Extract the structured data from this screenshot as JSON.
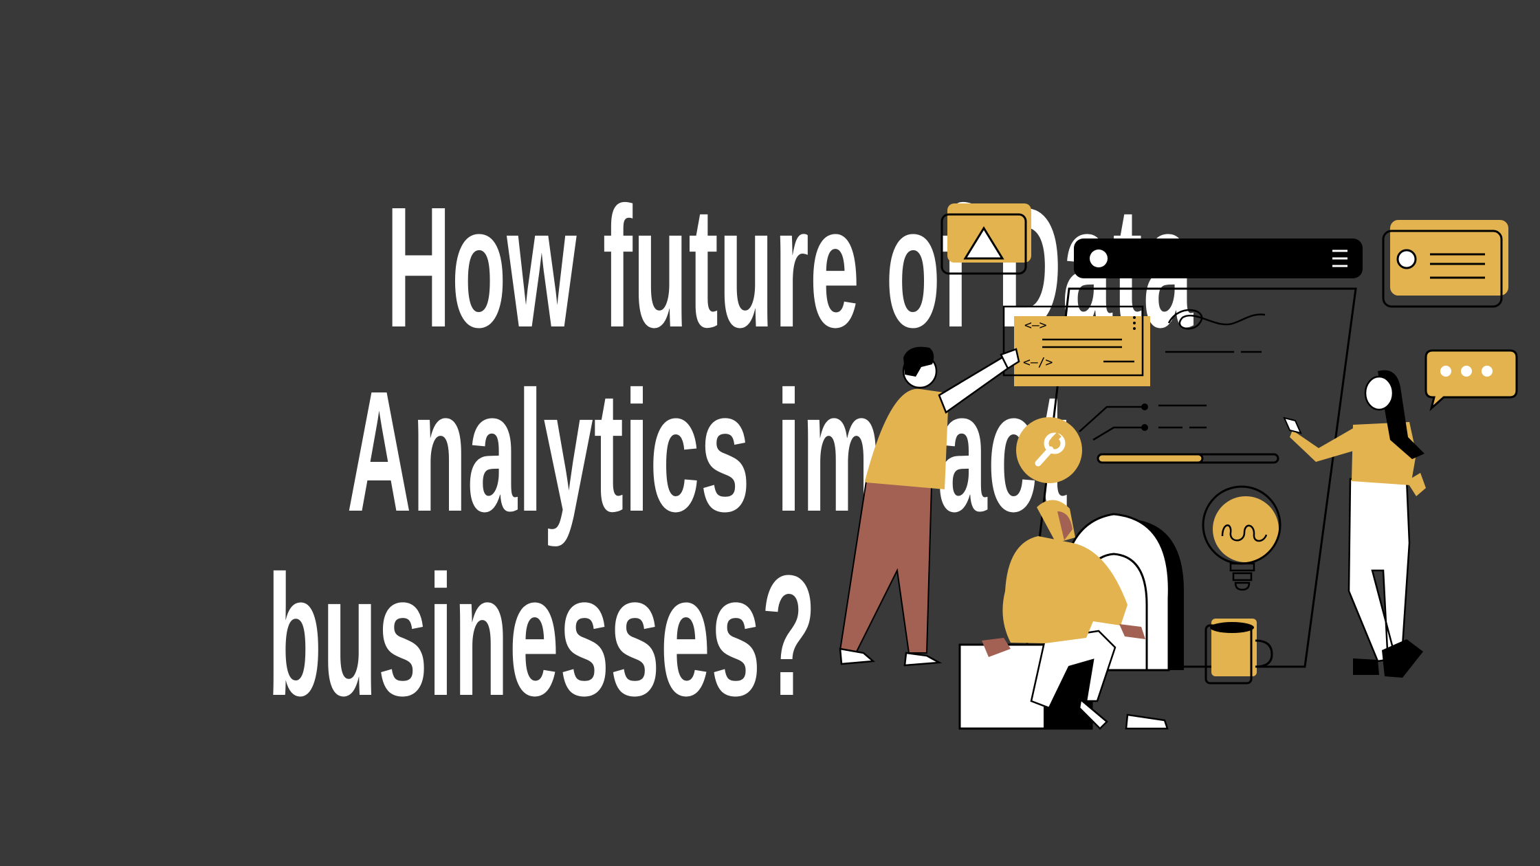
{
  "headline": {
    "line1": "How future of Data",
    "line2": "Analytics impact",
    "line3": "businesses?"
  },
  "illustration": {
    "window_code_open": "<—>",
    "window_code_close": "<—/>",
    "icons": [
      "warning-icon",
      "wrench-icon",
      "lightbulb-icon",
      "chat-dots-icon",
      "profile-card-icon",
      "menu-icon",
      "mug-icon"
    ],
    "progress": 0.58
  },
  "colors": {
    "background": "#393939",
    "text": "#ffffff",
    "accent": "#e3b350",
    "ink": "#000000",
    "pants": "#a36153"
  }
}
